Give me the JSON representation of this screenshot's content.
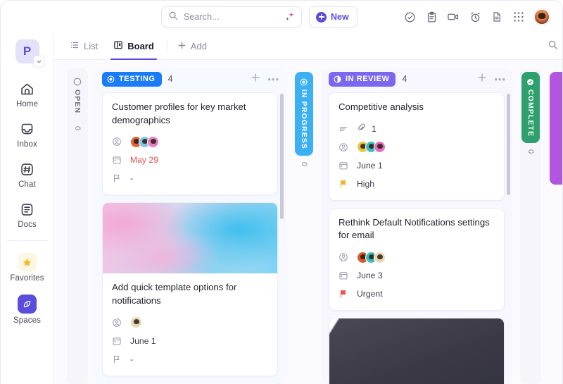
{
  "topbar": {
    "search": {
      "placeholder": "Search...",
      "icon": "search-icon",
      "ai_icon": "ai-sparkle-icon"
    },
    "new_button": {
      "label": "New",
      "icon": "plus-circle-icon"
    },
    "icons": [
      {
        "name": "check-circle-icon"
      },
      {
        "name": "clipboard-icon"
      },
      {
        "name": "video-camera-icon"
      },
      {
        "name": "alarm-clock-icon"
      },
      {
        "name": "document-icon"
      },
      {
        "name": "apps-grid-icon"
      }
    ],
    "avatar": {
      "name": "user-avatar",
      "color": "#d9793a"
    }
  },
  "sidebar": {
    "workspace": {
      "initial": "P",
      "color": "#5b4ddb",
      "bg": "#e4e1fb"
    },
    "items": [
      {
        "label": "Home",
        "icon": "home-icon"
      },
      {
        "label": "Inbox",
        "icon": "inbox-icon"
      },
      {
        "label": "Chat",
        "icon": "chat-hash-icon"
      },
      {
        "label": "Docs",
        "icon": "docs-icon"
      }
    ],
    "favorites": {
      "label": "Favorites",
      "icon": "star-icon"
    },
    "spaces": {
      "label": "Spaces",
      "icon": "spaces-icon",
      "active": true,
      "color": "#5b4ddb"
    }
  },
  "tabs": {
    "items": [
      {
        "label": "List",
        "icon": "list-icon",
        "active": false
      },
      {
        "label": "Board",
        "icon": "board-icon",
        "active": true
      }
    ],
    "add": {
      "label": "Add",
      "icon": "plus-icon"
    },
    "right_icons": [
      {
        "name": "search-icon"
      }
    ]
  },
  "board": {
    "columns": [
      {
        "id": "open",
        "label": "OPEN",
        "count": "0",
        "collapsed": true,
        "color": "#8a8a9e",
        "pill_bg": "transparent",
        "icon": "status-open-circle-icon"
      },
      {
        "id": "testing",
        "label": "TESTING",
        "count": "4",
        "collapsed": false,
        "color": "#ffffff",
        "pill_bg": "#1a7cf6",
        "icon": "status-target-icon",
        "add_label": "+",
        "menu_label": "•••",
        "cards": [
          {
            "title": "Customer profiles for key market demographics",
            "assignees": [
              "#e2653a",
              "#7fc6e8",
              "#e87fc0"
            ],
            "date": "May 29",
            "date_overdue": true,
            "priority": "-",
            "priority_color": "#9b9aab",
            "cover": null
          },
          {
            "title": "Add quick template options for notifications",
            "assignees": [
              "#e8d9b5"
            ],
            "date": "June 1",
            "date_overdue": false,
            "priority": "-",
            "priority_color": "#9b9aab",
            "cover": "watercolor"
          }
        ]
      },
      {
        "id": "in-progress",
        "label": "IN PROGRESS",
        "count": "0",
        "collapsed": true,
        "color": "#ffffff",
        "pill_bg": "#3bb0f5",
        "icon": "status-target-icon"
      },
      {
        "id": "in-review",
        "label": "IN REVIEW",
        "count": "4",
        "collapsed": false,
        "color": "#ffffff",
        "pill_bg": "#7b68ee",
        "icon": "status-half-circle-icon",
        "add_label": "+",
        "menu_label": "•••",
        "cards": [
          {
            "title": "Competitive analysis",
            "has_description": true,
            "attachments": "1",
            "assignees": [
              "#e8c54a",
              "#3fc0c0",
              "#e06fc4"
            ],
            "date": "June 1",
            "date_overdue": false,
            "priority": "High",
            "priority_color": "#f0b429",
            "cover": null
          },
          {
            "title": "Rethink Default Notifications settings for email",
            "assignees": [
              "#d95a2b",
              "#3fc0c0",
              "#e8d9b5"
            ],
            "date": "June 3",
            "date_overdue": false,
            "priority": "Urgent",
            "priority_color": "#e8534f",
            "cover": null
          },
          {
            "title": "",
            "cover": "dark-streaks"
          }
        ]
      },
      {
        "id": "complete",
        "label": "COMPLETE",
        "count": "0",
        "collapsed": true,
        "color": "#ffffff",
        "pill_bg": "#2ea06d",
        "icon": "status-check-circle-icon"
      },
      {
        "id": "closed",
        "label": "",
        "count": "",
        "collapsed": true,
        "color": "#ffffff",
        "pill_bg": "#b455e0",
        "icon": "status-target-icon"
      }
    ]
  }
}
